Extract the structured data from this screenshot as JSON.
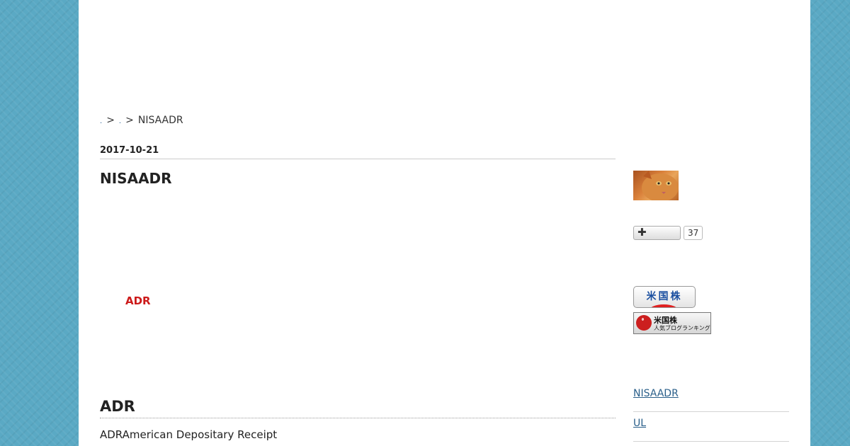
{
  "breadcrumb": {
    "sep": ">",
    "current": "NISAADR"
  },
  "article": {
    "date": "2017-10-21",
    "title": "NISAADR",
    "highlight": "ADR",
    "section_heading": "ADR",
    "section_text": "ADRAmerican Depositary Receipt"
  },
  "sidebar": {
    "follow_count": "37",
    "banner_us_stocks": "米国株",
    "banner_ranking": {
      "title": "米国株",
      "subtitle": "人気ブログランキング"
    },
    "recent_posts": [
      {
        "label": "NISAADR"
      },
      {
        "label": "UL"
      }
    ]
  },
  "colors": {
    "background": "#5aa9c4",
    "highlight": "#cc1a1a",
    "link": "#2a5f8a"
  },
  "icons": [
    "plus-icon",
    "ranking-logo-icon",
    "avatar-cat-image"
  ]
}
